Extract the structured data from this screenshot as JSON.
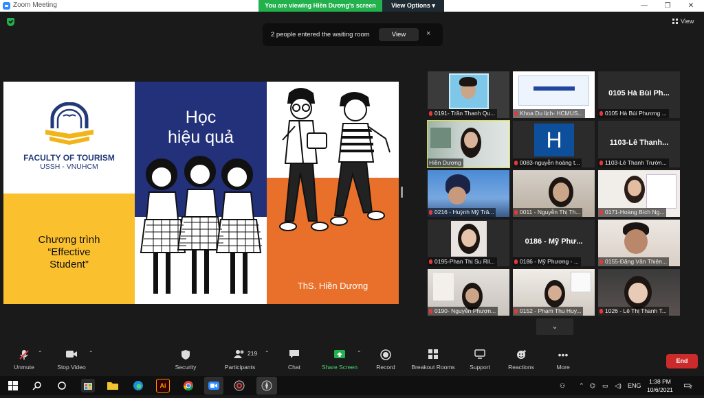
{
  "window": {
    "title": "Zoom Meeting",
    "controls": {
      "minimize": "—",
      "restore": "❐",
      "close": "✕"
    }
  },
  "share_bar": {
    "viewing_text": "You are viewing Hiền Dương's screen",
    "view_options": "View Options ▾"
  },
  "top_right": {
    "view_label": "View"
  },
  "notification": {
    "message": "2 people entered the waiting room",
    "button": "View",
    "close": "×"
  },
  "slide": {
    "faculty_line1": "FACULTY OF TOURISM",
    "faculty_line2": "USSH - VNUHCM",
    "title_line1": "Học",
    "title_line2": "hiệu quả",
    "program_line1": "Chương trình",
    "program_line2": "“Effective",
    "program_line3": "Student”",
    "presenter": "ThS. Hiền Dương"
  },
  "gallery": {
    "tiles": [
      {
        "name": "0191- Trần Thanh Qu...",
        "muted": true,
        "type": "video"
      },
      {
        "name": "Khoa Du lịch- HCMUS...",
        "muted": true,
        "type": "share"
      },
      {
        "name": "0105 Hà Bùi Phương ...",
        "muted": true,
        "type": "text",
        "big_name": "0105 Hà Bùi Ph..."
      },
      {
        "name": "Hiền Dương",
        "muted": false,
        "type": "video",
        "active": true
      },
      {
        "name": "0083-nguyễn hoàng t...",
        "muted": true,
        "type": "avatar",
        "letter": "H"
      },
      {
        "name": "1103-Lê Thanh Trườn...",
        "muted": true,
        "type": "text",
        "big_name": "1103-Lê Thanh..."
      },
      {
        "name": "0216 - Huỳnh Mỹ Trâ...",
        "muted": true,
        "type": "video"
      },
      {
        "name": "0011 - Nguyễn Thị Th...",
        "muted": true,
        "type": "video"
      },
      {
        "name": "0171-Hoàng Bích Ng...",
        "muted": true,
        "type": "video"
      },
      {
        "name": "0195-Phan Thị Su Ril...",
        "muted": true,
        "type": "video"
      },
      {
        "name": "0186 -  Mỹ Phương - ...",
        "muted": true,
        "type": "text",
        "big_name": "0186 -  Mỹ Phư..."
      },
      {
        "name": "0155-Đặng Văn Thiện...",
        "muted": true,
        "type": "video"
      },
      {
        "name": "0190- Nguyễn Phượn...",
        "muted": true,
        "type": "video"
      },
      {
        "name": "0152 - Phạm Thu Huy...",
        "muted": true,
        "type": "video"
      },
      {
        "name": "1026 - Lê Thị Thanh T...",
        "muted": true,
        "type": "video"
      }
    ],
    "next_page": "⌄"
  },
  "toolbar": {
    "unmute": "Unmute",
    "stop_video": "Stop Video",
    "security": "Security",
    "participants": "Participants",
    "participants_count": "219",
    "chat": "Chat",
    "share_screen": "Share Screen",
    "record": "Record",
    "breakout_rooms": "Breakout Rooms",
    "support": "Support",
    "reactions": "Reactions",
    "more": "More",
    "end": "End"
  },
  "taskbar": {
    "language": "ENG",
    "time": "1:38 PM",
    "date": "10/6/2021",
    "notification_count": "2"
  },
  "colors": {
    "share_green": "#23b14d",
    "end_red": "#cc2b2b",
    "slide_navy": "#23307a",
    "slide_yellow": "#fbc02d",
    "slide_orange": "#e8702a",
    "active_speaker": "#d9e04a"
  }
}
